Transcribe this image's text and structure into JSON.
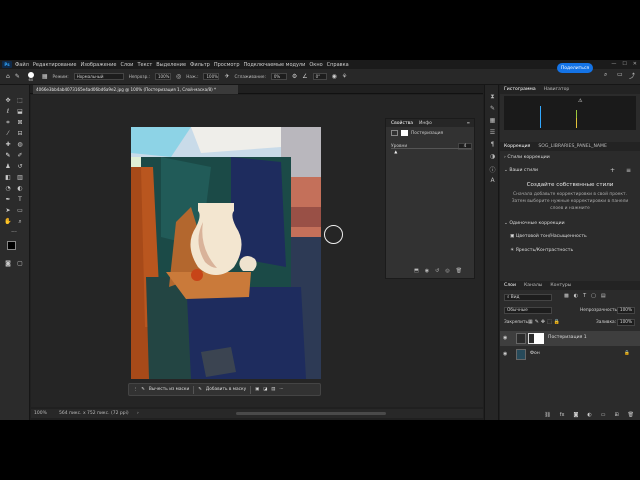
{
  "menu": {
    "items": [
      "Файл",
      "Редактирование",
      "Изображение",
      "Слои",
      "Текст",
      "Выделение",
      "Фильтр",
      "Просмотр",
      "Подключаемые модули",
      "Окно",
      "Справка"
    ],
    "app_icon": "Ps"
  },
  "options": {
    "brush_size": "60",
    "mode_label": "Режим:",
    "mode_value": "Нормальный",
    "opacity_label": "Непрозр.:",
    "opacity_value": "100%",
    "press_label": "Наж.:",
    "press_value": "100%",
    "smoothing_label": "Сглаживание:",
    "smoothing_value": "0%",
    "angle_value": "0°",
    "share_label": "Поделиться"
  },
  "document": {
    "tab_title": "4066e3bb4ab4073165e4ad06bd6a9e2.jpg @ 100% (Постеризация 1, Слой-маска/8) *",
    "zoom": "100%",
    "dimensions": "564 пикс. x 752 пикс. (72 ppi)"
  },
  "context_bar": {
    "subtract_label": "Вычесть из маски",
    "add_label": "Добавить в маску"
  },
  "properties": {
    "tab_properties": "Свойства",
    "tab_info": "Инфо",
    "layer_name": "Постеризация",
    "levels_label": "Уровни",
    "levels_value": "4",
    "levels_fraction": 0.04
  },
  "navigator": {
    "tab_histogram": "Гистограмма",
    "tab_navigator": "Навигатор"
  },
  "corrections": {
    "tab_label": "Коррекция",
    "tab_libraries": "SOG_LIBRARIES_PANEL_NAME",
    "styles_label": "Стили коррекции",
    "my_styles_label": "Ваши стили",
    "create_title": "Создайте собственные стили",
    "create_text_1": "Сначала добавьте корректировки в свой проект.",
    "create_text_2": "Затем выберите нужные корректировки в панели",
    "create_text_3": "слоев и нажмите",
    "single_label": "Одиночные коррекции",
    "item_1": "Цветовой тон/Насыщенность",
    "item_2": "Яркость/Контрастность"
  },
  "layers": {
    "tab_layers": "Слои",
    "tab_channels": "Каналы",
    "tab_paths": "Контуры",
    "filter_label": "Вид",
    "blend_mode": "Обычные",
    "opacity_label": "Непрозрачность:",
    "opacity_value": "100%",
    "lock_label": "Закрепить:",
    "fill_label": "Заливка:",
    "fill_value": "100%",
    "rows": [
      {
        "name": "Постеризация 1",
        "selected": true
      },
      {
        "name": "Фон",
        "selected": false
      }
    ]
  },
  "colors": {
    "accent": "#1473e6",
    "workspace": "#252525",
    "panel": "#2b2b2b"
  }
}
